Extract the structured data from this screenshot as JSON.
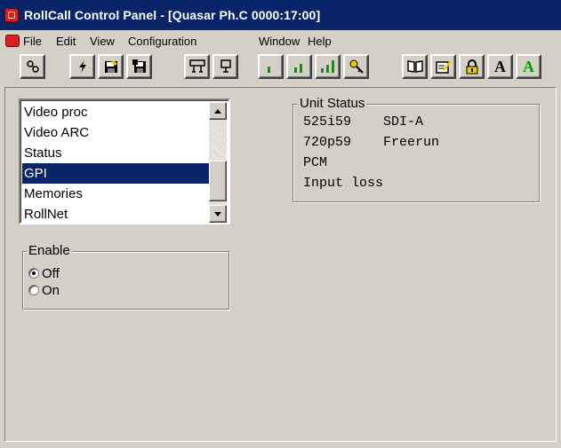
{
  "window": {
    "title": "RollCall Control Panel - [Quasar Ph.C 0000:17:00]"
  },
  "menu": {
    "items": [
      "File",
      "Edit",
      "View",
      "Configuration",
      "Window",
      "Help"
    ]
  },
  "toolbar": {
    "buttons": [
      {
        "icon": "connect-icon"
      },
      {
        "icon": "lightning-icon"
      },
      {
        "icon": "save-icon"
      },
      {
        "icon": "save-all-icon"
      },
      {
        "icon": "network-icon"
      },
      {
        "icon": "unit-icon"
      },
      {
        "icon": "signal-low-icon"
      },
      {
        "icon": "signal-medium-icon"
      },
      {
        "icon": "signal-high-icon"
      },
      {
        "icon": "key-icon"
      },
      {
        "icon": "book-icon"
      },
      {
        "icon": "edit-icon"
      },
      {
        "icon": "lock-icon"
      },
      {
        "icon": "font-black-icon",
        "label": "A"
      },
      {
        "icon": "font-green-icon",
        "label": "A"
      }
    ]
  },
  "list": {
    "items": [
      "Video proc",
      "Video ARC",
      "Status",
      "GPI",
      "Memories",
      "RollNet"
    ],
    "selected": "GPI"
  },
  "unit_status": {
    "title": "Unit Status",
    "lines": [
      "525i59    SDI-A",
      "720p59    Freerun",
      "PCM",
      "Input loss"
    ]
  },
  "enable": {
    "title": "Enable",
    "options": [
      "Off",
      "On"
    ],
    "selected": "Off"
  },
  "colors": {
    "titlebar": "#0a246a",
    "selection": "#0a246a",
    "face": "#d4d0c8",
    "green_icon": "#00a000",
    "yellow_icon": "#e8c800"
  }
}
